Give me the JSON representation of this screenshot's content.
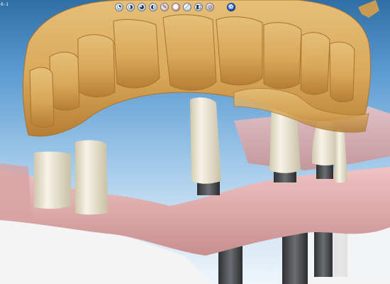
{
  "app": {
    "corner_label": "0-1"
  },
  "toolbar": {
    "buttons": [
      {
        "id": "view-front",
        "icon": "tooth-front-view-icon",
        "glyph": "◔",
        "variant": ""
      },
      {
        "id": "view-side",
        "icon": "tooth-side-view-icon",
        "glyph": "◑",
        "variant": ""
      },
      {
        "id": "view-top",
        "icon": "tooth-top-view-icon",
        "glyph": "◕",
        "variant": ""
      },
      {
        "id": "view-left",
        "icon": "tooth-left-view-icon",
        "glyph": "◐",
        "variant": ""
      },
      {
        "id": "paint",
        "icon": "paint-brush-icon",
        "glyph": "✎",
        "variant": "pink"
      },
      {
        "id": "record",
        "icon": "record-icon",
        "glyph": "●",
        "variant": "red"
      },
      {
        "id": "probe",
        "icon": "probe-icon",
        "glyph": "⟋",
        "variant": ""
      },
      {
        "id": "transparency",
        "icon": "transparency-icon",
        "glyph": "◧",
        "variant": ""
      },
      {
        "id": "material",
        "icon": "material-icon",
        "glyph": "◎",
        "variant": "pink"
      },
      {
        "id": "navigate",
        "icon": "navigation-icon",
        "glyph": "✿",
        "variant": "nav"
      }
    ]
  },
  "scene": {
    "colors": {
      "teeth": "#d8a95d",
      "gingiva": "#e6b1b1",
      "abutments": "#ece6cf",
      "implant_posts": "#4b4d51",
      "model_base": "#f4f4f4"
    }
  }
}
